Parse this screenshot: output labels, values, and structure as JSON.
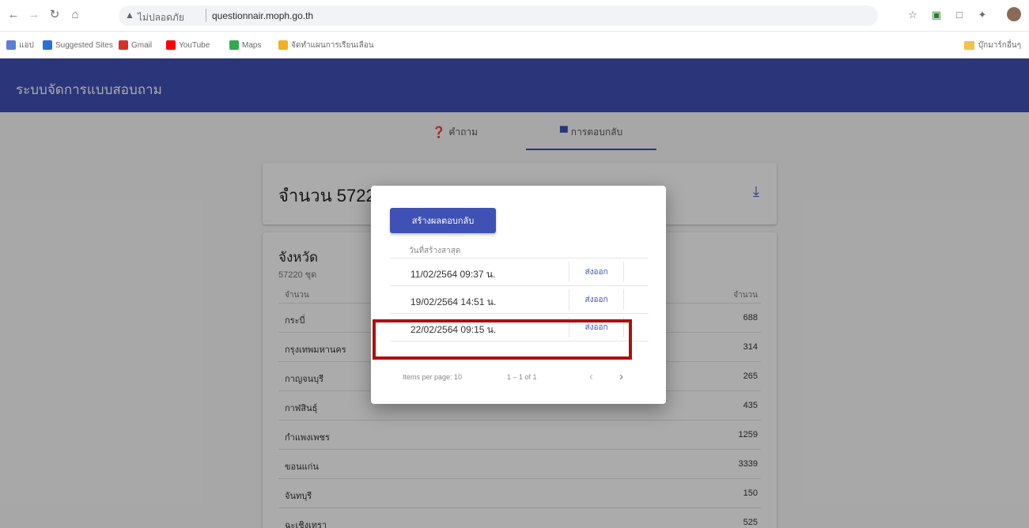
{
  "browser": {
    "url_insecure_label": "ไม่ปลอดภัย",
    "url": "questionnair.moph.go.th",
    "bookmarks": [
      {
        "label": "แอป",
        "color": "#5b7fd6"
      },
      {
        "label": "Suggested Sites",
        "color": "#2a6fd6"
      },
      {
        "label": "Gmail",
        "color": "#d93025"
      },
      {
        "label": "YouTube",
        "color": "#ff0000"
      },
      {
        "label": "Maps",
        "color": "#34a853"
      },
      {
        "label": "จัดทำแผนการเรียนเลือน",
        "color": "#f2b01e"
      }
    ],
    "other_bookmarks": "บุ๊กมาร์กอื่นๆ"
  },
  "app": {
    "title": "ระบบจัดการแบบสอบถาม",
    "tabs": [
      {
        "label": "คำถาม",
        "icon": "help-icon"
      },
      {
        "label": "การตอบกลับ",
        "icon": "forum-icon"
      }
    ],
    "active_tab": 1
  },
  "summary": {
    "count_text": "จำนวน 57220 ชุด"
  },
  "province_table": {
    "title": "จังหวัด",
    "subtitle": "57220 ชุด",
    "col_name": "จำนวน",
    "col_count": "จำนวน",
    "rows": [
      {
        "name": "กระบี่",
        "count": "688"
      },
      {
        "name": "กรุงเทพมหานคร",
        "count": "314"
      },
      {
        "name": "กาญจนบุรี",
        "count": "265"
      },
      {
        "name": "กาฬสินธุ์",
        "count": "435"
      },
      {
        "name": "กำแพงเพชร",
        "count": "1259"
      },
      {
        "name": "ขอนแก่น",
        "count": "3339"
      },
      {
        "name": "จันทบุรี",
        "count": "150"
      },
      {
        "name": "ฉะเชิงเทรา",
        "count": "525"
      }
    ]
  },
  "dialog": {
    "create_button": "สร้างผลตอบกลับ",
    "col_header": "วันที่สร้างสาสุด",
    "rows": [
      {
        "date": "11/02/2564 09:37 น.",
        "action": "ส่งออก"
      },
      {
        "date": "19/02/2564 14:51 น.",
        "action": "ส่งออก"
      },
      {
        "date": "22/02/2564 09:15 น.",
        "action": "ส่งออก"
      }
    ],
    "paginator": {
      "items_per_page": "Items per page: 10",
      "range": "1 – 1 of 1"
    }
  },
  "colors": {
    "primary": "#3f51b5",
    "highlight": "#b00e0e"
  }
}
